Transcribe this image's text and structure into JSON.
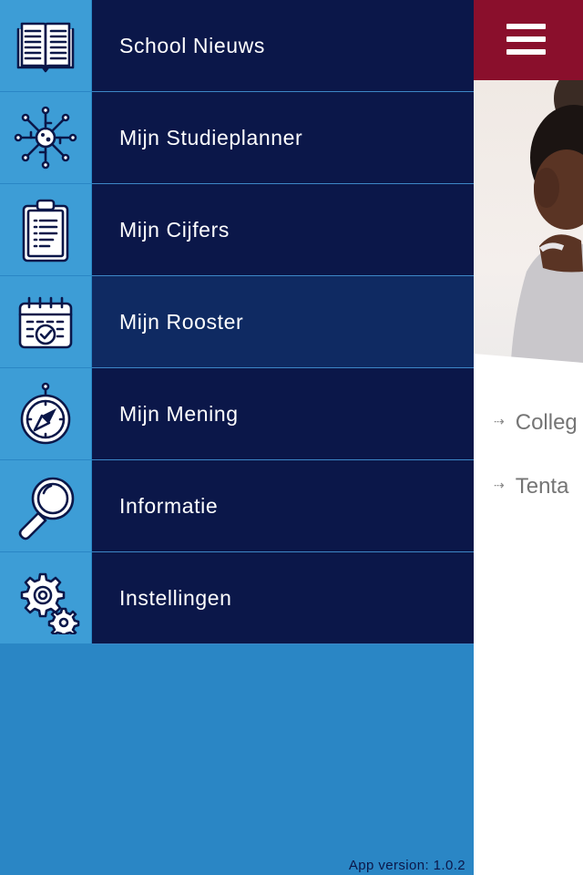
{
  "menu": {
    "items": [
      {
        "label": "School Nieuws",
        "icon": "open-book-icon"
      },
      {
        "label": "Mijn Studieplanner",
        "icon": "network-icon"
      },
      {
        "label": "Mijn Cijfers",
        "icon": "clipboard-icon"
      },
      {
        "label": "Mijn Rooster",
        "icon": "calendar-check-icon",
        "active": true
      },
      {
        "label": "Mijn Mening",
        "icon": "compass-icon"
      },
      {
        "label": "Informatie",
        "icon": "magnifier-icon"
      },
      {
        "label": "Instellingen",
        "icon": "gears-icon"
      }
    ],
    "version": "App version: 1.0.2"
  },
  "content": {
    "links": [
      "Colleg",
      "Tenta"
    ]
  },
  "colors": {
    "menu_background": "#2a86c5",
    "icon_cell": "#3d9dd6",
    "label_cell": "#0b1749",
    "active_label_cell": "#0f2a62",
    "topbar": "#8a0f2c"
  }
}
